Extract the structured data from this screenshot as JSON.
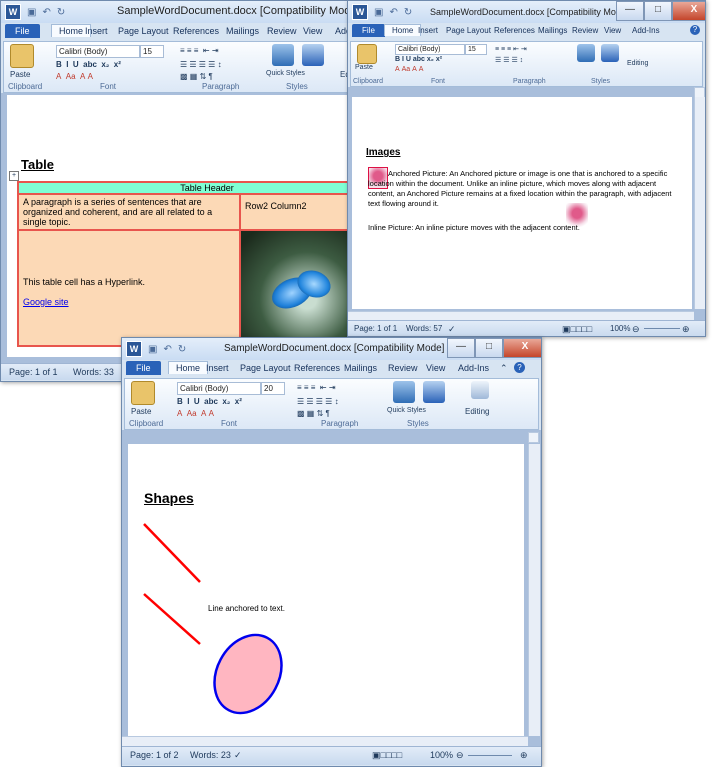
{
  "common": {
    "qat_icons": [
      "save-icon",
      "undo-icon",
      "redo-icon",
      "customize-icon"
    ],
    "window_buttons": [
      "—",
      "□",
      "X"
    ],
    "tabs": [
      "File",
      "Home",
      "Insert",
      "Page Layout",
      "References",
      "Mailings",
      "Review",
      "View",
      "Add-Ins"
    ],
    "font_name": "Calibri (Body)",
    "groups": [
      "Clipboard",
      "Font",
      "Paragraph",
      "Styles",
      "Editing"
    ],
    "paste": "Paste",
    "quick_styles": "Quick Styles",
    "change_styles": "Change Styles",
    "editing": "Editing"
  },
  "win1": {
    "title": "SampleWordDocument.docx [Compatibility Mode] - Microsoft Word",
    "font_size": "15",
    "heading": "Table",
    "table": {
      "header": "Table Header",
      "r1c1": "A paragraph is a series of sentences that are organized and coherent, and are all related to a single topic.",
      "r1c2": "Row2 Column2",
      "r2c1_text": "This table cell has a Hyperlink.",
      "r2c1_link": "Google site"
    },
    "status_page": "Page: 1 of 1",
    "status_words": "Words: 33"
  },
  "win2": {
    "title": "SampleWordDocument.docx [Compatibility Mode] - Microsoft Word",
    "font_size": "15",
    "heading": "Images",
    "anchored_text": "Anchored Picture: An Anchored picture or image is one that is anchored to a specific location within the document. Unlike an inline picture, which moves along with adjacent content, an Anchored Picture remains at a fixed location within the paragraph, with adjacent text flowing around it.",
    "inline_text": "Inline Picture: An inline picture moves with the adjacent content.",
    "status_page": "Page: 1 of 1",
    "status_words": "Words: 57",
    "zoom": "100%"
  },
  "win3": {
    "title": "SampleWordDocument.docx [Compatibility Mode] - Microsoft Word",
    "font_size": "20",
    "heading": "Shapes",
    "line_text": "Line anchored to text.",
    "status_page": "Page: 1 of 2",
    "status_words": "Words: 23",
    "zoom": "100%"
  },
  "colors": {
    "accent": "#2a62b8",
    "table_header": "#7fffd4",
    "table_cell": "#fcd9b6",
    "table_border": "#e8554d",
    "shape_line": "#ff0000",
    "ellipse_fill": "#ffb6c1",
    "ellipse_stroke": "#0000ee"
  }
}
